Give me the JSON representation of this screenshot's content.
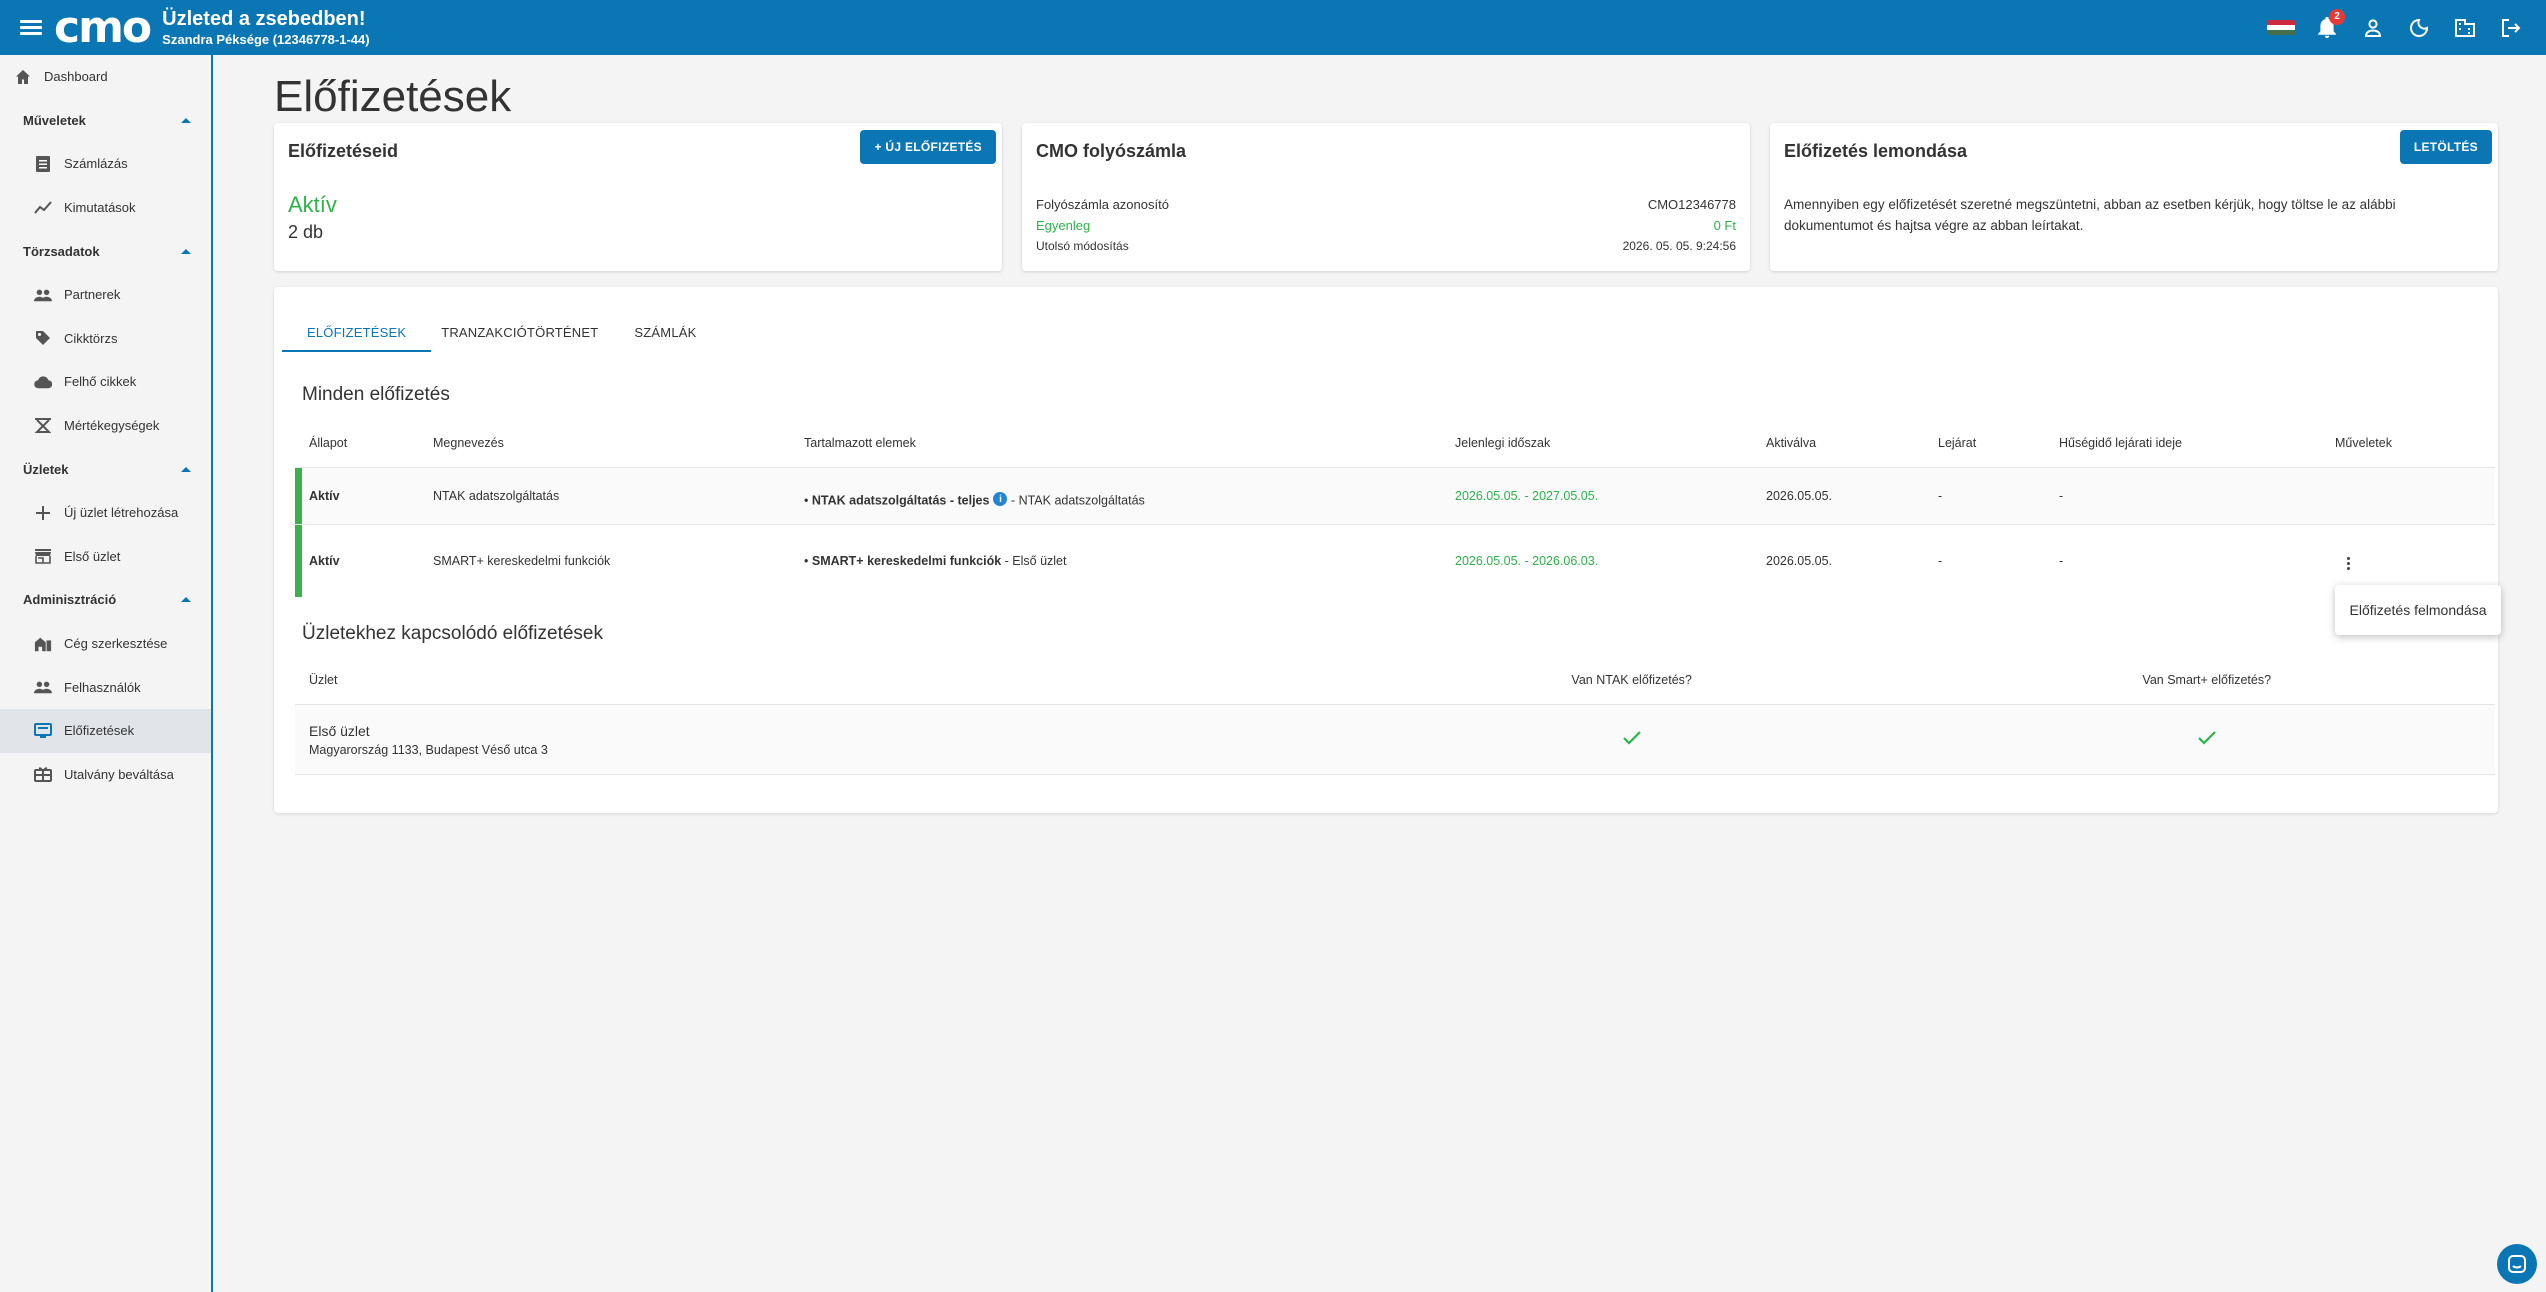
{
  "header": {
    "logo": "cmo",
    "title": "Üzleted a zsebedben!",
    "subtitle": "Szandra Péksége (12346778-1-44)",
    "notification_count": "2"
  },
  "sidebar": {
    "dashboard": "Dashboard",
    "sections": {
      "muveletek": "Műveletek",
      "torzsadatok": "Törzsadatok",
      "uzletek": "Üzletek",
      "adminisztracio": "Adminisztráció"
    },
    "items": {
      "szamlazas": "Számlázás",
      "kimutatasok": "Kimutatások",
      "partnerek": "Partnerek",
      "cikktorzs": "Cikktörzs",
      "felho_cikkek": "Felhő cikkek",
      "mertekegysegek": "Mértékegységek",
      "uj_uzlet": "Új üzlet létrehozása",
      "elso_uzlet": "Első üzlet",
      "ceg": "Cég szerkesztése",
      "felhasznalok": "Felhasználók",
      "elofizetesek": "Előfizetések",
      "utalvany": "Utalvány beváltása"
    }
  },
  "page": {
    "title": "Előfizetések"
  },
  "cards": {
    "subscriptions": {
      "title": "Előfizetéseid",
      "button": "+ ÚJ ELŐFIZETÉS",
      "status": "Aktív",
      "count": "2 db"
    },
    "account": {
      "title": "CMO folyószámla",
      "id_label": "Folyószámla azonosító",
      "id_value": "CMO12346778",
      "balance_label": "Egyenleg",
      "balance_value": "0 Ft",
      "modified_label": "Utolsó módosítás",
      "modified_value": "2026. 05. 05. 9:24:56"
    },
    "cancel": {
      "title": "Előfizetés lemondása",
      "button": "LETÖLTÉS",
      "text": "Amennyiben egy előfizetését szeretné megszüntetni, abban az esetben kérjük, hogy töltse le az alábbi dokumentumot és hajtsa végre az abban leírtakat."
    }
  },
  "tabs": [
    "ELŐFIZETÉSEK",
    "TRANZAKCIÓTÖRTÉNET",
    "SZÁMLÁK"
  ],
  "all_subs": {
    "title": "Minden előfizetés",
    "headers": [
      "Állapot",
      "Megnevezés",
      "Tartalmazott elemek",
      "Jelenlegi időszak",
      "Aktiválva",
      "Lejárat",
      "Hűségidő lejárati ideje",
      "Műveletek"
    ],
    "rows": [
      {
        "status": "Aktív",
        "name": "NTAK adatszolgáltatás",
        "item_bold": "NTAK adatszolgáltatás - teljes",
        "item_rest": "- NTAK adatszolgáltatás",
        "info_icon": "i",
        "period": "2026.05.05. - 2027.05.05.",
        "activated": "2026.05.05.",
        "expiry": "-",
        "loyalty": "-"
      },
      {
        "status": "Aktív",
        "name": "SMART+ kereskedelmi funkciók",
        "item_bold": "SMART+ kereskedelmi funkciók",
        "item_rest": "- Első üzlet",
        "period": "2026.05.05. - 2026.06.03.",
        "activated": "2026.05.05.",
        "expiry": "-",
        "loyalty": "-"
      }
    ]
  },
  "store_subs": {
    "title": "Üzletekhez kapcsolódó előfizetések",
    "headers": [
      "Üzlet",
      "Van NTAK előfizetés?",
      "Van Smart+ előfizetés?"
    ],
    "rows": [
      {
        "name": "Első üzlet",
        "address": "Magyarország 1133, Budapest Véső utca 3"
      }
    ]
  },
  "context_menu": {
    "item": "Előfizetés felmondása"
  },
  "colors": {
    "primary": "#0a76b4",
    "active_green": "#2db34a"
  }
}
